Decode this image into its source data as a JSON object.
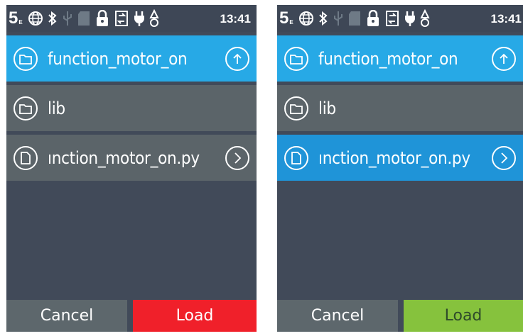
{
  "screens": [
    {
      "id": "left",
      "status": {
        "mode_number": "5",
        "mode_sub": "E",
        "time": "13:41"
      },
      "header": {
        "label": "function_motor_on",
        "action_icon": "up-arrow-icon"
      },
      "items": [
        {
          "label": "lib",
          "icon": "folder-icon",
          "selected": false
        },
        {
          "label": "ınction_motor_on.py",
          "icon": "file-icon",
          "selected": false
        }
      ],
      "footer": {
        "cancel_label": "Cancel",
        "load_label": "Load",
        "load_color": "#f0202a"
      }
    },
    {
      "id": "right",
      "status": {
        "mode_number": "5",
        "mode_sub": "E",
        "time": "13:41"
      },
      "header": {
        "label": "function_motor_on",
        "action_icon": "up-arrow-icon"
      },
      "items": [
        {
          "label": "lib",
          "icon": "folder-icon",
          "selected": false
        },
        {
          "label": "ınction_motor_on.py",
          "icon": "file-icon",
          "selected": true
        }
      ],
      "footer": {
        "cancel_label": "Cancel",
        "load_label": "Load",
        "load_color": "#86c23d"
      }
    }
  ],
  "colors": {
    "background": "#414a59",
    "header": "#27a9e6",
    "row": "#5b6469",
    "row_selected": "#1f94d8"
  }
}
